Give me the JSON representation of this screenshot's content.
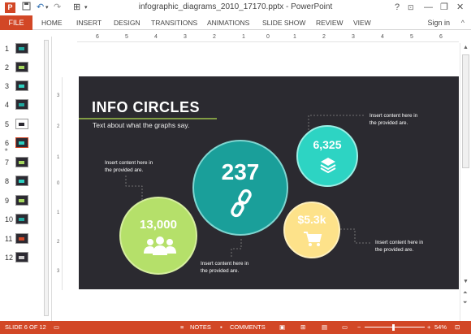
{
  "titlebar": {
    "app_icon": "P",
    "doc_title": "infographic_diagrams_2010_17170.pptx - PowerPoint",
    "help": "?",
    "minimize": "—",
    "restore": "❐",
    "close": "✕",
    "ribbon_display": "⊡"
  },
  "ribbon": {
    "file": "FILE",
    "tabs": [
      "HOME",
      "INSERT",
      "DESIGN",
      "TRANSITIONS",
      "ANIMATIONS",
      "SLIDE SHOW",
      "REVIEW",
      "VIEW"
    ],
    "signin": "Sign in",
    "collapse": "^"
  },
  "ruler": {
    "h_labels": [
      "6",
      "5",
      "4",
      "3",
      "2",
      "1",
      "0",
      "1",
      "2",
      "3",
      "4",
      "5",
      "6"
    ],
    "v_labels": [
      "3",
      "2",
      "1",
      "0",
      "1",
      "2",
      "3"
    ]
  },
  "thumbnails": [
    {
      "num": "1",
      "marker": "#1fa89f"
    },
    {
      "num": "2",
      "marker": "#a4d65e"
    },
    {
      "num": "3",
      "marker": "#2dcfc0"
    },
    {
      "num": "4",
      "marker": "#1fa89f"
    },
    {
      "num": "5",
      "marker": "#ffd966"
    },
    {
      "num": "6",
      "marker": "#2dcfc0"
    },
    {
      "num": "7",
      "marker": "#a4d65e"
    },
    {
      "num": "8",
      "marker": "#2dcfc0"
    },
    {
      "num": "9",
      "marker": "#a4d65e"
    },
    {
      "num": "10",
      "marker": "#1fa89f"
    },
    {
      "num": "11",
      "marker": "#d24726"
    },
    {
      "num": "12",
      "marker": "#cccccc"
    }
  ],
  "slide": {
    "title": "INFO CIRCLES",
    "subtitle": "Text about what the graphs say.",
    "circles": [
      {
        "value": "237",
        "icon": "link-icon",
        "color": "#1a9f9a"
      },
      {
        "value": "13,000",
        "icon": "users-icon",
        "color": "#b5e06a"
      },
      {
        "value": "6,325",
        "icon": "layers-icon",
        "color": "#2dd4c3"
      },
      {
        "value": "$5.3k",
        "icon": "cart-icon",
        "color": "#fde28a"
      }
    ],
    "captions": {
      "top_right": [
        "Insert content here in",
        "the provided are."
      ],
      "left": [
        "Insert content here in",
        "the provided are."
      ],
      "bottom": [
        "Insert content here in",
        "the provided are."
      ],
      "right": [
        "Insert content here in",
        "the provided are."
      ]
    }
  },
  "statusbar": {
    "slide_info": "SLIDE 6 OF 12",
    "notes": "NOTES",
    "comments": "COMMENTS",
    "zoom": "54%"
  },
  "colors": {
    "accent": "#d24726",
    "slide_bg": "#2b2a30"
  }
}
